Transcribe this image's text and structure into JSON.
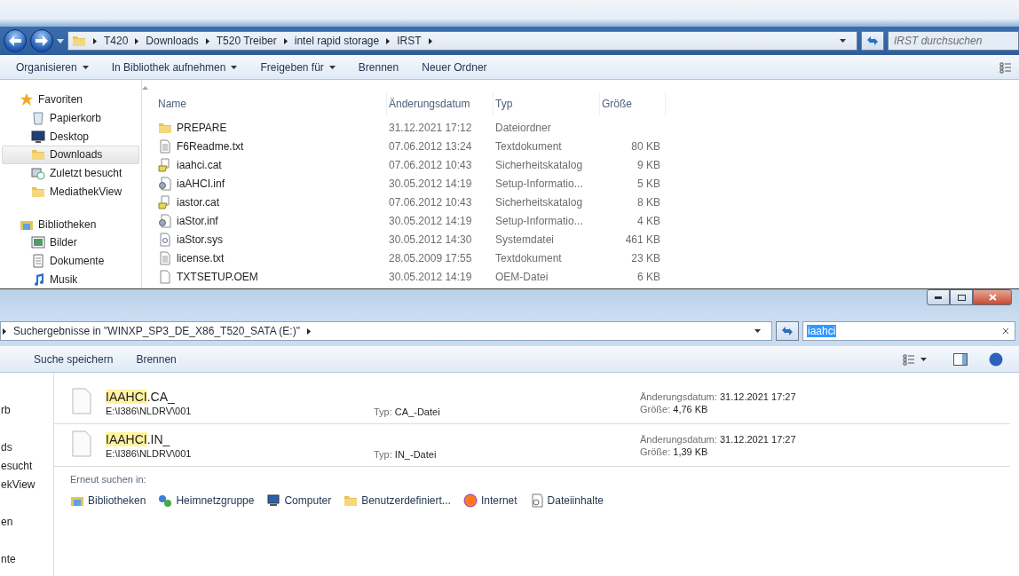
{
  "back_window": {
    "breadcrumb": [
      "T420",
      "Downloads",
      "T520 Treiber",
      "intel rapid storage",
      "IRST"
    ],
    "search": {
      "placeholder": "IRST durchsuchen"
    },
    "toolbar": [
      {
        "label": "Organisieren",
        "dropdown": true
      },
      {
        "label": "In Bibliothek aufnehmen",
        "dropdown": true
      },
      {
        "label": "Freigeben für",
        "dropdown": true
      },
      {
        "label": "Brennen",
        "dropdown": false
      },
      {
        "label": "Neuer Ordner",
        "dropdown": false
      }
    ],
    "sidebar": [
      {
        "title": "Favoriten",
        "items": [
          {
            "label": "Papierkorb",
            "selected": false
          },
          {
            "label": "Desktop",
            "selected": false
          },
          {
            "label": "Downloads",
            "selected": true
          },
          {
            "label": "Zuletzt besucht",
            "selected": false
          },
          {
            "label": "MediathekView",
            "selected": false
          }
        ]
      },
      {
        "title": "Bibliotheken",
        "items": [
          {
            "label": "Bilder",
            "selected": false
          },
          {
            "label": "Dokumente",
            "selected": false
          },
          {
            "label": "Musik",
            "selected": false
          }
        ]
      }
    ],
    "table": {
      "columns": [
        "Name",
        "Änderungsdatum",
        "Typ",
        "Größe"
      ],
      "rows": [
        {
          "name": "PREPARE",
          "date": "31.12.2021 17:12",
          "type": "Dateiordner"
        },
        {
          "name": "F6Readme.txt",
          "date": "07.06.2012 13:24",
          "type": "Textdokument",
          "size": "80 KB"
        },
        {
          "name": "iaahci.cat",
          "date": "07.06.2012 10:43",
          "type": "Sicherheitskatalog",
          "size": "9 KB"
        },
        {
          "name": "iaAHCI.inf",
          "date": "30.05.2012 14:19",
          "type": "Setup-Informatio...",
          "size": "5 KB"
        },
        {
          "name": "iastor.cat",
          "date": "07.06.2012 10:43",
          "type": "Sicherheitskatalog",
          "size": "8 KB"
        },
        {
          "name": "iaStor.inf",
          "date": "30.05.2012 14:19",
          "type": "Setup-Informatio...",
          "size": "4 KB"
        },
        {
          "name": "iaStor.sys",
          "date": "30.05.2012 14:30",
          "type": "Systemdatei",
          "size": "461 KB"
        },
        {
          "name": "license.txt",
          "date": "28.05.2009 17:55",
          "type": "Textdokument",
          "size": "23 KB"
        },
        {
          "name": "TXTSETUP.OEM",
          "date": "30.05.2012 14:19",
          "type": "OEM-Datei",
          "size": "6 KB"
        }
      ]
    }
  },
  "front_window": {
    "address": "Suchergebnisse in \"WINXP_SP3_DE_X86_T520_SATA (E:)\"",
    "search": {
      "value": "iaahci"
    },
    "toolbar": [
      "Suche speichern",
      "Brennen"
    ],
    "sidebar": [
      {
        "kind": "blank"
      },
      {
        "kind": "text",
        "label": "rb"
      },
      {
        "kind": "blank"
      },
      {
        "kind": "text",
        "label": "ds"
      },
      {
        "kind": "text",
        "label": "esucht"
      },
      {
        "kind": "text",
        "label": "ekView"
      },
      {
        "kind": "blank"
      },
      {
        "kind": "text",
        "label": "en"
      },
      {
        "kind": "blank"
      },
      {
        "kind": "text",
        "label": "nte"
      }
    ],
    "results": [
      {
        "match": "IAAHCI",
        "rest": ".CA_",
        "path": "E:\\I386\\NLDRV\\001",
        "type_label": "Typ:",
        "type": "CA_-Datei",
        "date_label": "Änderungsdatum:",
        "date": "31.12.2021 17:27",
        "size_label": "Größe:",
        "size": "4,76 KB"
      },
      {
        "match": "IAAHCI",
        "rest": ".IN_",
        "path": "E:\\I386\\NLDRV\\001",
        "type_label": "Typ:",
        "type": "IN_-Datei",
        "date_label": "Änderungsdatum:",
        "date": "31.12.2021 17:27",
        "size_label": "Größe:",
        "size": "1,39 KB"
      }
    ],
    "search_again": {
      "label": "Erneut suchen in:",
      "items": [
        "Bibliotheken",
        "Heimnetzgruppe",
        "Computer",
        "Benutzerdefiniert...",
        "Internet",
        "Dateiinhalte"
      ]
    }
  }
}
